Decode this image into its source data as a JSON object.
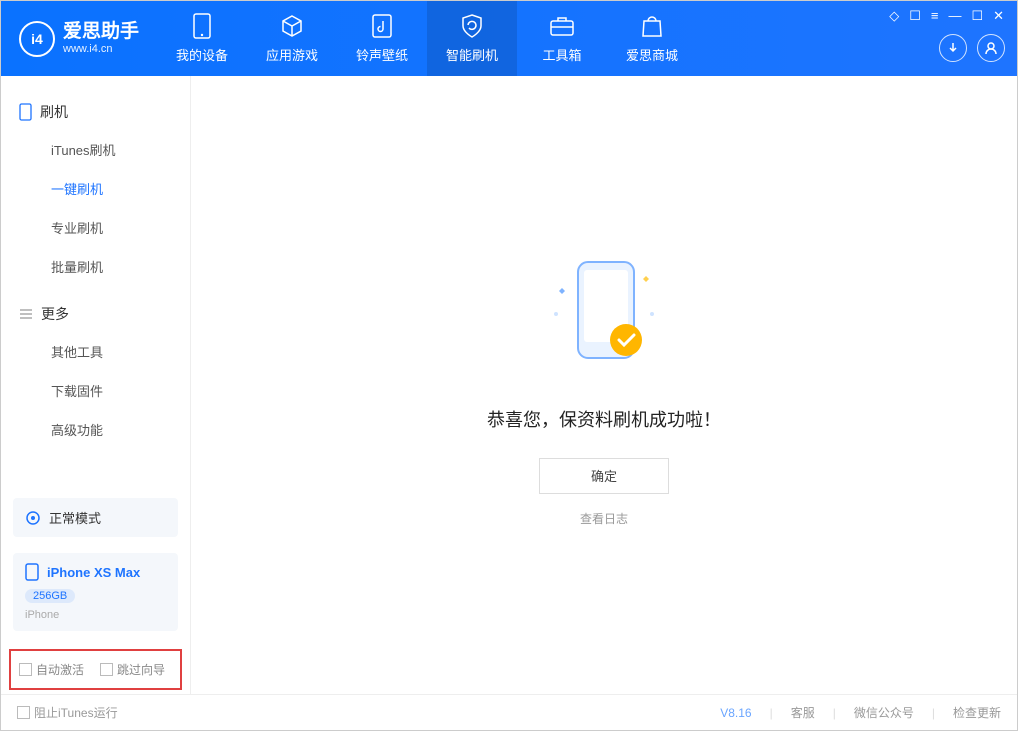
{
  "app": {
    "title": "爱思助手",
    "subtitle": "www.i4.cn"
  },
  "nav": {
    "items": [
      {
        "label": "我的设备"
      },
      {
        "label": "应用游戏"
      },
      {
        "label": "铃声壁纸"
      },
      {
        "label": "智能刷机"
      },
      {
        "label": "工具箱"
      },
      {
        "label": "爱思商城"
      }
    ],
    "activeIndex": 3
  },
  "sidebar": {
    "group1": {
      "title": "刷机",
      "items": [
        "iTunes刷机",
        "一键刷机",
        "专业刷机",
        "批量刷机"
      ],
      "activeIndex": 1
    },
    "group2": {
      "title": "更多",
      "items": [
        "其他工具",
        "下载固件",
        "高级功能"
      ]
    }
  },
  "device": {
    "mode": "正常模式",
    "name": "iPhone XS Max",
    "capacity": "256GB",
    "type": "iPhone"
  },
  "checkboxes": {
    "autoActivate": "自动激活",
    "skipGuide": "跳过向导"
  },
  "main": {
    "message": "恭喜您，保资料刷机成功啦！",
    "okButton": "确定",
    "logLink": "查看日志"
  },
  "footer": {
    "blockItunes": "阻止iTunes运行",
    "version": "V8.16",
    "links": [
      "客服",
      "微信公众号",
      "检查更新"
    ]
  }
}
